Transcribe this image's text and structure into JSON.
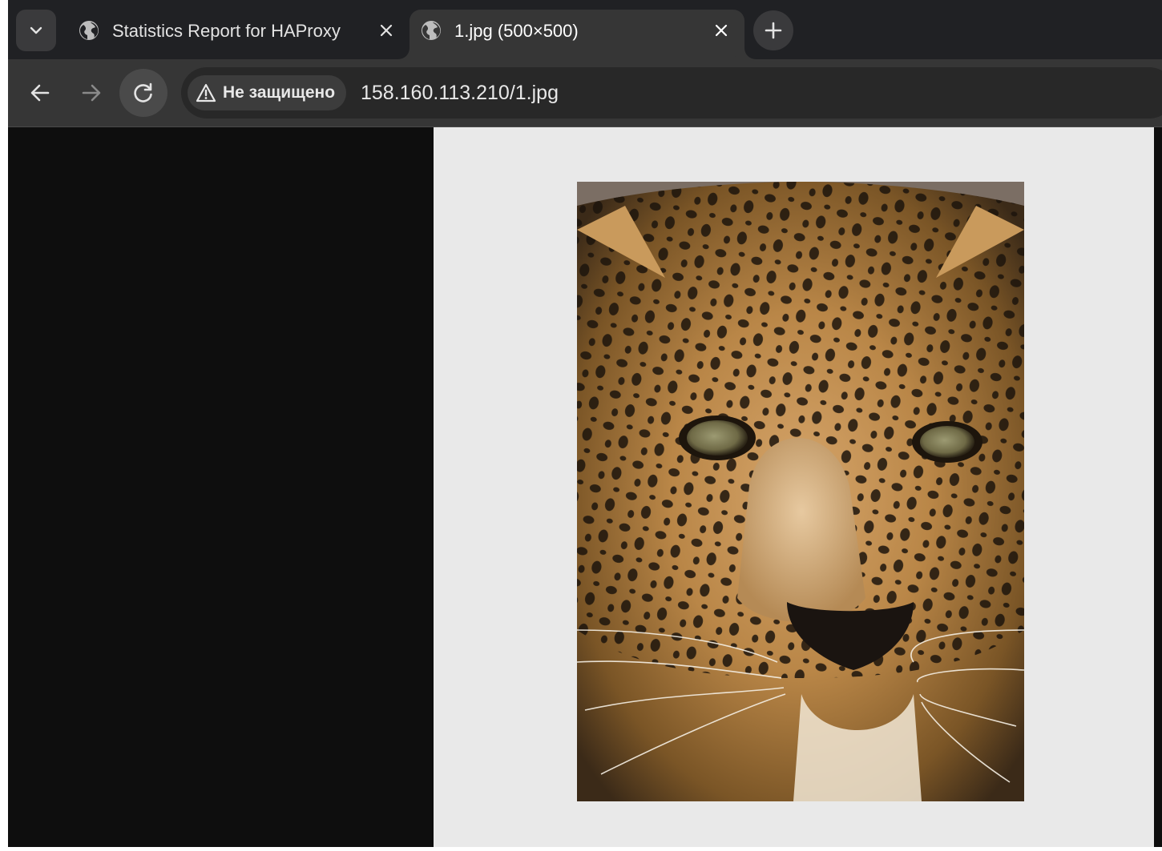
{
  "browser": {
    "tabs": [
      {
        "title": "Statistics Report for HAProxy",
        "active": false,
        "favicon": "globe-icon"
      },
      {
        "title": "1.jpg (500×500)",
        "active": true,
        "favicon": "globe-icon"
      }
    ],
    "toolbar": {
      "security_label": "Не защищено",
      "url": "158.160.113.210/1.jpg"
    }
  },
  "content": {
    "image_description_icon": "leopard-photo",
    "page_background": "#0e0e0e",
    "image_background": "#e9e9e9"
  }
}
